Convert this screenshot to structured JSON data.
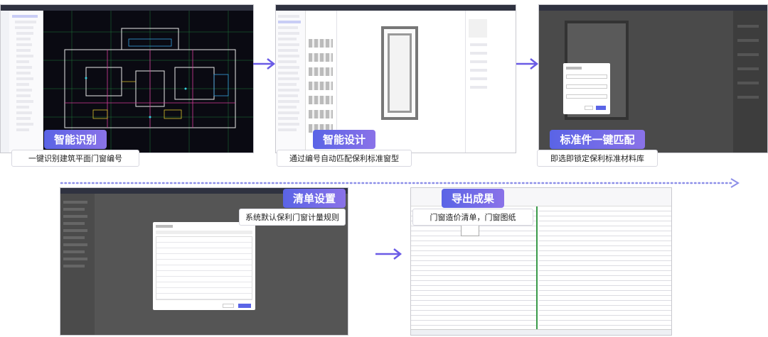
{
  "steps": [
    {
      "title": "智能识别",
      "subtitle": "一键识别建筑平面门窗编号"
    },
    {
      "title": "智能设计",
      "subtitle": "通过编号自动匹配保利标准窗型"
    },
    {
      "title": "标准件一键匹配",
      "subtitle": "即选即锁定保利标准材料库"
    },
    {
      "title": "清单设置",
      "subtitle": "系统默认保利门窗计量规则"
    },
    {
      "title": "导出成果",
      "subtitle": "门窗造价清单，门窗图纸"
    }
  ],
  "colors": {
    "accent": "#5a64e6",
    "accent2": "#8a72e8",
    "cad_bg": "#0a0a12"
  }
}
